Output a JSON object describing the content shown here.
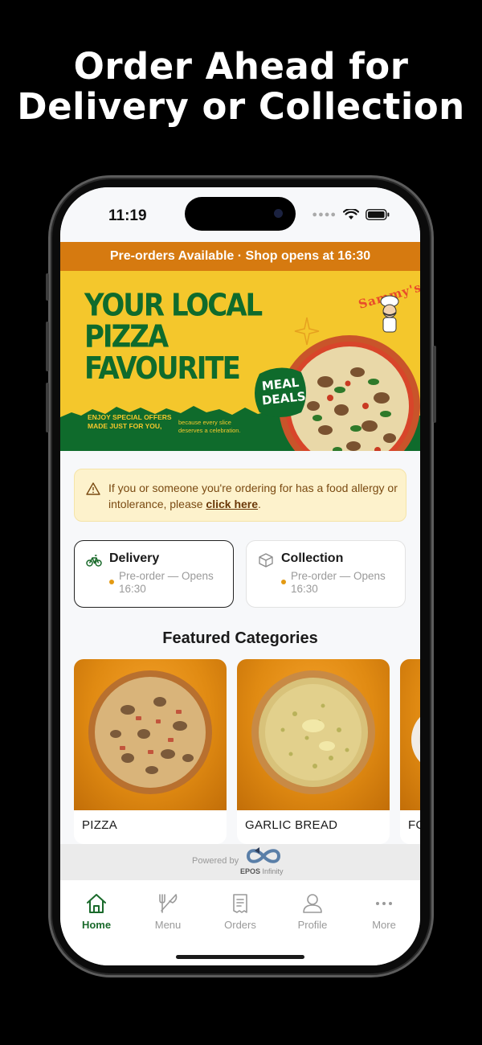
{
  "headline": {
    "line1": "Order Ahead for",
    "line2": "Delivery or Collection"
  },
  "status_bar": {
    "time": "11:19",
    "icons": [
      "signal-dots-icon",
      "wifi-icon",
      "battery-icon"
    ]
  },
  "preorder_banner": "Pre-orders Available · Shop opens at 16:30",
  "hero": {
    "title_lines": [
      "YOUR LOCAL",
      "PIZZA",
      "FAVOURITE"
    ],
    "offer_line1": "ENJOY SPECIAL OFFERS",
    "offer_line2": "MADE JUST FOR YOU,",
    "tag_line1": "because every slice",
    "tag_line2": "deserves a celebration.",
    "badge_line1": "MEAL",
    "badge_line2": "DEALS",
    "logo": "Sammy's",
    "colors": {
      "background": "#f4c72c",
      "green": "#0f6b2c"
    }
  },
  "allergy_notice": {
    "text": "If you or someone you're ordering for has a food allergy or intolerance, please ",
    "link": "click here",
    "end": ".",
    "icon": "warning-icon"
  },
  "order_modes": [
    {
      "label": "Delivery",
      "status": "Pre-order — Opens 16:30",
      "selected": true,
      "icon": "bicycle-icon"
    },
    {
      "label": "Collection",
      "status": "Pre-order — Opens 16:30",
      "selected": false,
      "icon": "box-icon"
    }
  ],
  "featured": {
    "title": "Featured Categories",
    "categories": [
      {
        "label": "PIZZA"
      },
      {
        "label": "GARLIC BREAD"
      },
      {
        "label": "FO"
      }
    ]
  },
  "powered_by": {
    "text": "Powered by",
    "brand": "EPOS",
    "brand_suffix": "Infinity"
  },
  "tabs": [
    {
      "label": "Home",
      "icon": "home-icon",
      "active": true
    },
    {
      "label": "Menu",
      "icon": "fork-knife-icon",
      "active": false
    },
    {
      "label": "Orders",
      "icon": "receipt-icon",
      "active": false
    },
    {
      "label": "Profile",
      "icon": "user-icon",
      "active": false
    },
    {
      "label": "More",
      "icon": "more-dots-icon",
      "active": false
    }
  ],
  "colors": {
    "accent_orange": "#d67a10",
    "active_green": "#1a6a2b",
    "allergy_bg": "#fdf2cc"
  }
}
